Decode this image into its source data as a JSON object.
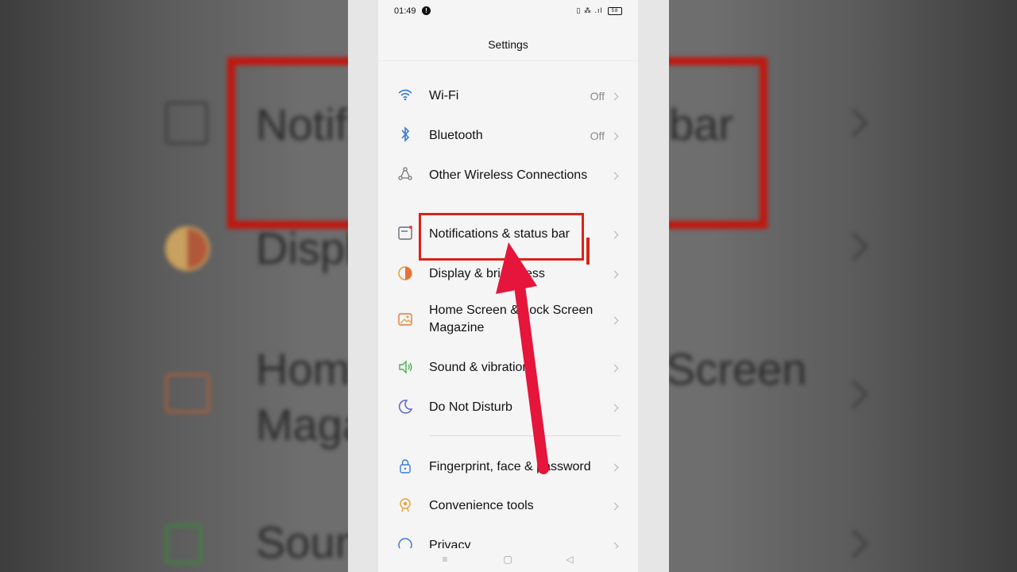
{
  "status_bar": {
    "time": "01:49",
    "notification_badge": "!",
    "indicators": "▯ ⁂ .ıl",
    "battery": "58"
  },
  "header": {
    "title": "Settings"
  },
  "settings_groups": [
    {
      "items": [
        {
          "label": "Wi-Fi",
          "value": "Off",
          "icon": "wifi-icon"
        },
        {
          "label": "Bluetooth",
          "value": "Off",
          "icon": "bluetooth-icon"
        },
        {
          "label": "Other Wireless Connections",
          "value": "",
          "icon": "wireless-connections-icon"
        }
      ]
    },
    {
      "items": [
        {
          "label": "Notifications & status bar",
          "value": "",
          "icon": "notification-icon"
        },
        {
          "label": "Display & brightness",
          "value": "",
          "icon": "display-brightness-icon"
        },
        {
          "label": "Home Screen & Lock Screen Magazine",
          "value": "",
          "icon": "wallpaper-icon"
        },
        {
          "label": "Sound & vibration",
          "value": "",
          "icon": "sound-icon"
        },
        {
          "label": "Do Not Disturb",
          "value": "",
          "icon": "moon-icon"
        }
      ]
    },
    {
      "items": [
        {
          "label": "Fingerprint, face & password",
          "value": "",
          "icon": "lock-icon"
        },
        {
          "label": "Convenience tools",
          "value": "",
          "icon": "convenience-icon"
        },
        {
          "label": "Privacy",
          "value": "",
          "icon": "privacy-icon"
        }
      ]
    }
  ],
  "nav_bar": {
    "menu": "≡",
    "home": "▢",
    "back": "◁"
  },
  "background_text": {
    "notif": "Notif",
    "bar": "bar",
    "displ": "Displ",
    "hom": "Hom",
    "maga": "Maga",
    "screen": "Screen",
    "soun": "Soun"
  },
  "colors": {
    "annotation_red": "#d8231a",
    "arrow_red": "#e5153b",
    "wifi": "#3a7bd5",
    "bluetooth": "#3a7bd5"
  }
}
